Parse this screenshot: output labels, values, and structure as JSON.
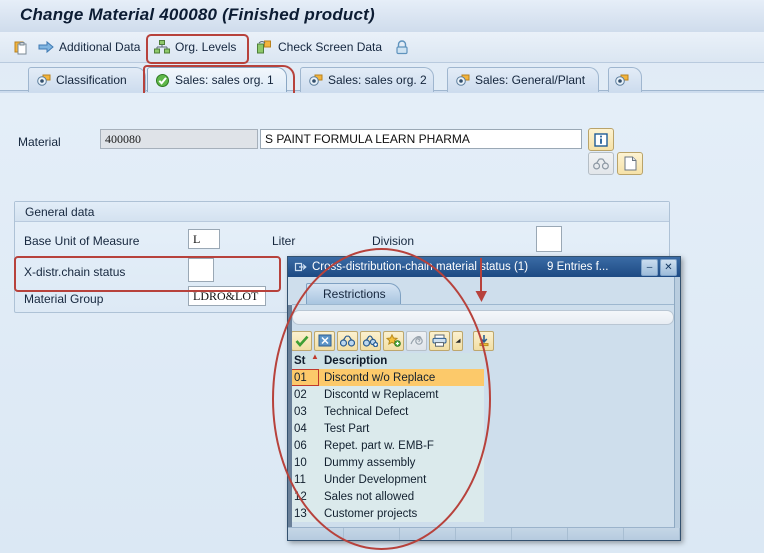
{
  "window": {
    "title": "Change Material 400080 (Finished product)"
  },
  "toolbar": {
    "items": [
      {
        "icon": "copy-icon",
        "label": ""
      },
      {
        "icon": "arrow-right-icon",
        "label": "Additional Data"
      },
      {
        "icon": "org-levels-icon",
        "label": "Org. Levels"
      },
      {
        "icon": "check-screen-icon",
        "label": "Check Screen Data"
      },
      {
        "icon": "lock-icon",
        "label": ""
      }
    ]
  },
  "tabs": {
    "items": [
      {
        "label": "Classification",
        "icon": "tab-icon",
        "active": false
      },
      {
        "label": "Sales: sales org. 1",
        "icon": "green-check-icon",
        "active": true
      },
      {
        "label": "Sales: sales org. 2",
        "icon": "tab-icon",
        "active": false
      },
      {
        "label": "Sales: General/Plant",
        "icon": "tab-icon",
        "active": false
      },
      {
        "label": "",
        "icon": "tab-icon",
        "active": false
      }
    ],
    "nav": [
      {
        "name": "prev",
        "glyph": "◀"
      },
      {
        "name": "next",
        "glyph": "▶"
      },
      {
        "name": "list",
        "glyph": "❐"
      }
    ]
  },
  "material": {
    "label": "Material",
    "number": "400080",
    "description": "S PAINT FORMULA LEARN PHARMA",
    "info_button": "information-icon",
    "binoculars_button": "binoculars-icon",
    "doc_button": "document-icon"
  },
  "general_data": {
    "header": "General data",
    "fields": {
      "base_unit_label": "Base Unit of Measure",
      "base_unit_value": "L",
      "base_unit_text": "Liter",
      "division_label": "Division",
      "division_value": "",
      "xdistr_label": "X-distr.chain status",
      "xdistr_value": "",
      "material_group_label": "Material Group",
      "material_group_value": "LDRO&LOT"
    }
  },
  "dialog": {
    "title": "Cross-distribution-chain material status (1)",
    "subtitle": "9 Entries f...",
    "title_icon": "dialog-icon",
    "minimize_glyph": "–",
    "close_glyph": "✕",
    "tab_label": "Restrictions",
    "toolbar_icons": [
      "check-icon",
      "cancel-icon",
      "find-icon",
      "find-next-icon",
      "add-favorite-icon",
      "personal-list-icon",
      "print-icon",
      "print-dropdown-icon",
      "download-icon"
    ],
    "columns": [
      "St",
      "Description"
    ],
    "sort_indicator": "▲",
    "rows": [
      {
        "st": "01",
        "description": "Discontd w/o Replace",
        "selected": true
      },
      {
        "st": "02",
        "description": "Discontd w Replacemt",
        "selected": false
      },
      {
        "st": "03",
        "description": "Technical Defect",
        "selected": false
      },
      {
        "st": "04",
        "description": "Test Part",
        "selected": false
      },
      {
        "st": "06",
        "description": "Repet. part w. EMB-F",
        "selected": false
      },
      {
        "st": "10",
        "description": "Dummy assembly",
        "selected": false
      },
      {
        "st": "11",
        "description": "Under Development",
        "selected": false
      },
      {
        "st": "12",
        "description": "Sales not allowed",
        "selected": false
      },
      {
        "st": "13",
        "description": "Customer projects",
        "selected": false
      }
    ]
  },
  "annotations": {
    "color": "#b7423c",
    "shapes": [
      "org-levels-highlight",
      "active-tab-highlight",
      "xdistr-field-highlight",
      "popup-ellipse-highlight"
    ]
  }
}
